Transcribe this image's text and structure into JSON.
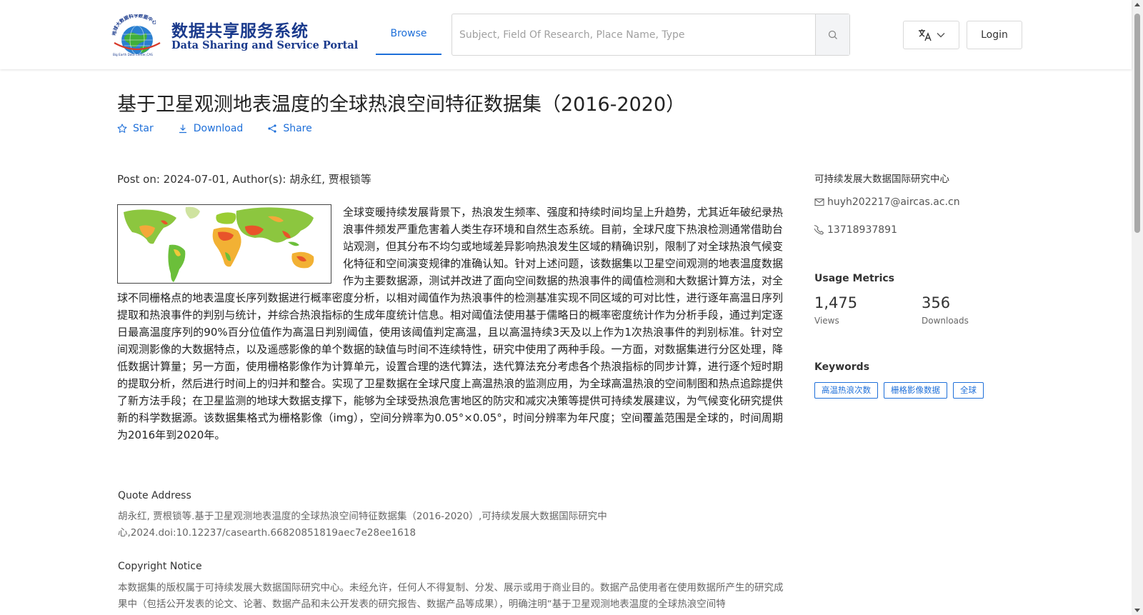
{
  "header": {
    "logo": {
      "name_cn": "数据共享服务系统",
      "name_en": "Data Sharing and Service Portal",
      "org_arc_text": "地球大数据科学数据中心",
      "org_en_small": "Big Earth Data Center,CAS"
    },
    "nav": {
      "browse_label": "Browse"
    },
    "search": {
      "placeholder": "Subject, Field Of Research, Place Name, Type",
      "value": ""
    },
    "login_label": "Login"
  },
  "dataset": {
    "title": "基于卫星观测地表温度的全球热浪空间特征数据集（2016-2020）",
    "actions": {
      "star": "Star",
      "download": "Download",
      "share": "Share"
    },
    "post_on": "Post on: 2024-07-01, Author(s): 胡永红, 贾根锁等",
    "abstract": "全球变暖持续发展背景下，热浪发生频率、强度和持续时间均呈上升趋势，尤其近年破纪录热浪事件频发严重危害着人类生存环境和自然生态系统。目前，全球尺度下热浪检测通常借助台站观测，但其分布不均匀或地域差异影响热浪发生区域的精确识别，限制了对全球热浪气候变化特征和空间演变规律的准确认知。针对上述问题，该数据集以卫星空间观测的地表温度数据作为主要数据源，测试并改进了面向空间数据的热浪事件的阈值检测和大数据计算方法，对全球不同栅格点的地表温度长序列数据进行概率密度分析，以相对阈值作为热浪事件的检测基准实现不同区域的可对比性，进行逐年高温日序列提取和热浪事件的判别与统计，并综合热浪指标的生成年度统计信息。相对阈值法使用基于儒略日的概率密度统计作为分析手段，通过判定逐日最高温度序列的90%百分位值作为高温日判别阈值，使用该阈值判定高温，且以高温持续3天及以上作为1次热浪事件的判别标准。针对空间观测影像的大数据特点，以及遥感影像的单个数据的缺值与时间不连续特性，研究中使用了两种手段。一方面，对数据集进行分区处理，降低数据计算量；另一方面，使用栅格影像作为计算单元，设置合理的迭代算法，迭代算法充分考虑各个热浪指标的同步计算，进行逐个短时期的提取分析，然后进行时间上的归并和整合。实现了卫星数据在全球尺度上高温热浪的监测应用，为全球高温热浪的空间制图和热点追踪提供了新方法手段；在卫星监测的地球大数据支撑下，能够为全球受热浪危害地区的防灾和减灾决策等提供可持续发展建议，为气候变化研究提供新的科学数据源。该数据集格式为栅格影像（img），空间分辨率为0.05°×0.05°，时间分辨率为年尺度；空间覆盖范围是全球的，时间周期为2016年到2020年。",
    "quote": {
      "label": "Quote Address",
      "text": "胡永红, 贾根锁等.基于卫星观测地表温度的全球热浪空间特征数据集（2016-2020）,可持续发展大数据国际研究中心,2024.doi:10.12237/casearth.66820851819aec7e28ee1618"
    },
    "copyright": {
      "label": "Copyright Notice",
      "text": "本数据集的版权属于可持续发展大数据国际研究中心。未经允许，任何人不得复制、分发、展示或用于商业目的。数据产品使用者在使用数据所产生的研究成果中（包括公开发表的论文、论著、数据产品和未公开发表的研究报告、数据产品等成果），明确注明“基于卫星观测地表温度的全球热浪空间特"
    }
  },
  "sidebar": {
    "org": "可持续发展大数据国际研究中心",
    "email": "huyh202217@aircas.ac.cn",
    "phone": "13718937891",
    "usage": {
      "heading": "Usage Metrics",
      "views_value": "1,475",
      "views_label": "Views",
      "downloads_value": "356",
      "downloads_label": "Downloads"
    },
    "keywords": {
      "heading": "Keywords",
      "items": [
        "高温热浪次数",
        "栅格影像数据",
        "全球"
      ]
    }
  },
  "colors": {
    "accent": "#1e6fd9",
    "logo_blue": "#1a3a8c"
  },
  "icons": [
    "globe-logo-icon",
    "search-icon",
    "translate-icon",
    "chevron-down-icon",
    "star-icon",
    "download-icon",
    "share-icon",
    "mail-icon",
    "phone-icon"
  ]
}
